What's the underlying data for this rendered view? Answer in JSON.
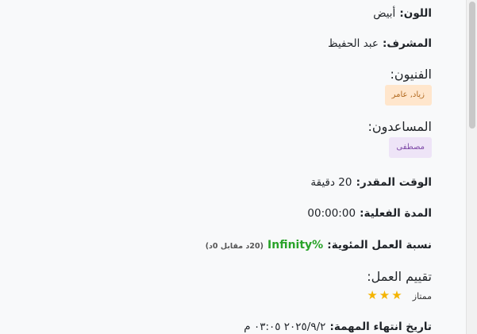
{
  "details": {
    "color_label": "اللون:",
    "color_value": "أبيض",
    "supervisor_label": "المشرف:",
    "supervisor_value": "عبد الحفيظ",
    "technicians_label": "الفنيون:",
    "technicians_value": "زياد, عامر",
    "assistants_label": "المساعدون:",
    "assistants_value": "مصطفى",
    "estimated_label": "الوقت المقدر:",
    "estimated_value": "20 دقيقة",
    "actual_label": "المدة الفعلية:",
    "actual_value": "00:00:00",
    "work_pct_label": "نسبة العمل المئوية:",
    "work_pct_value": "Infinity%",
    "work_pct_note": "(20د مقابل 0د)",
    "rating_label": "تقييم العمل:",
    "rating_text": "ممتاز",
    "end_label": "تاريخ انتهاء المهمة:",
    "end_value": "٢٠٢٥/٩/٢ ٠٣:٠٥ م"
  },
  "rating_stars": 3,
  "colors": {
    "technicians_pill_bg": "#ffe6cc",
    "assistants_pill_bg": "#eee4f7",
    "percentage_green": "#29a329",
    "star_gold": "#f4b400"
  }
}
